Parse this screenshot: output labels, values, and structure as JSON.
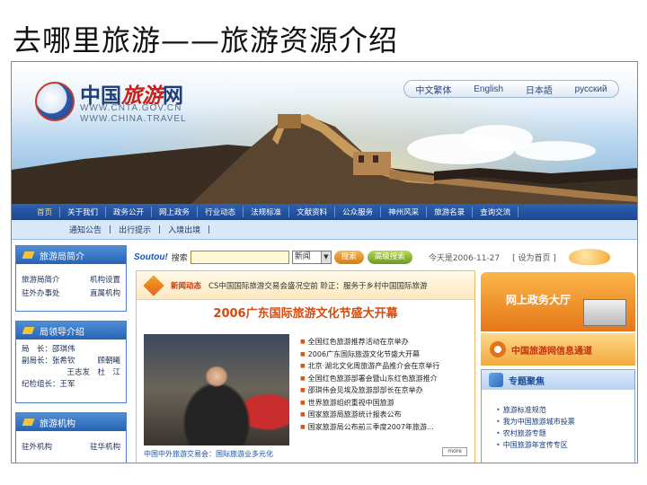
{
  "slide": {
    "title": "去哪里旅游——旅游资源介绍"
  },
  "site": {
    "logo_text_a": "中国",
    "logo_text_b": "旅游",
    "logo_text_c": "网",
    "url_1": "WWW.CNTA.GOV.CN",
    "url_2": "WWW.CHINA.TRAVEL"
  },
  "languages": [
    "中文繁体",
    "English",
    "日本語",
    "русский"
  ],
  "nav": {
    "items": [
      "首页",
      "关于我们",
      "政务公开",
      "网上政务",
      "行业动态",
      "法规标准",
      "文献资料",
      "公众服务",
      "神州风采",
      "旅游名录",
      "查询交流"
    ],
    "active_index": 0
  },
  "subnav": {
    "items": [
      "通知公告",
      "|",
      "出行提示",
      "|",
      "入境出境",
      "|"
    ]
  },
  "left": {
    "box1": {
      "title": "旅游局简介",
      "rows": [
        [
          "旅游局简介",
          "机构设置"
        ],
        [
          "驻外办事处",
          "直属机构"
        ]
      ]
    },
    "box2": {
      "title": "局领导介绍",
      "rows": [
        [
          "局　长：邵琪伟",
          ""
        ],
        [
          "副局长：张希钦",
          "顾朝曦"
        ],
        [
          "",
          "王志发　杜　江"
        ],
        [
          "纪检组长：王军",
          ""
        ]
      ]
    },
    "box3": {
      "title": "旅游机构",
      "rows": [
        [
          "驻外机构",
          "驻华机构"
        ]
      ]
    }
  },
  "search": {
    "logo": "Soutou!",
    "label": "搜索",
    "select_value": "新闻",
    "search_button": "搜索",
    "advanced_button": "高级搜索",
    "date": "今天是2006-11-27",
    "set_home": "[ 设为首页 ]"
  },
  "news": {
    "label": "新闻动态",
    "ticker": "CS中国国际旅游交易会盛况空前 聆正：服务于乡村中国国际旅游",
    "headline": "2006广东国际旅游文化节盛大开幕",
    "items": [
      "全国红色旅游推荐活动在京举办",
      "2006广东国际旅游文化节盛大开幕",
      "北京·湖北文化周旅游产品推介会在京举行",
      "全国红色旅游部署会暨山东红色旅游推介",
      "邵琪伟会见埃及旅游部部长在京举办",
      "世界旅游组织重视中国旅游",
      "国家旅游局旅游统计报表公布",
      "国家旅游局公布前三季度2007年旅游..."
    ],
    "caption": "中国中外旅游交易会：国际旅游业多元化",
    "more": "more"
  },
  "right": {
    "gov_hall": "网上政务大厅",
    "info_channel": "中国旅游网信息通道",
    "special_title": "专题聚焦",
    "special_items": [
      "旅游标准规范",
      "我为中国旅游城市投票",
      "农村旅游专题",
      "中国旅游年宣传专区"
    ]
  }
}
